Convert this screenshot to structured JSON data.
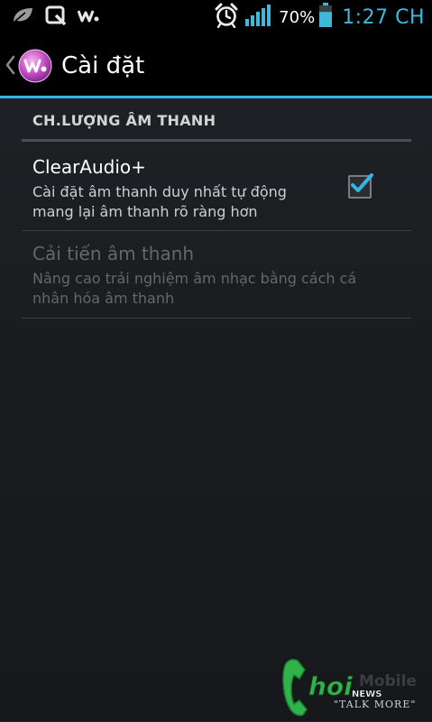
{
  "status_bar": {
    "icons_left": [
      "leaf-icon",
      "quickmemo-icon",
      "walkman-icon"
    ],
    "icons_right": [
      "alarm-icon",
      "signal-icon",
      "battery-icon"
    ],
    "battery_percent": "70%",
    "battery_level": 0.7,
    "time": "1:27 CH",
    "accent_color": "#3fb8d9"
  },
  "action_bar": {
    "title": "Cài đặt",
    "app_icon": "walkman-app-icon",
    "accent_color": "#33b5e5"
  },
  "settings": {
    "section_header": "CH.LƯỢNG ÂM THANH",
    "items": [
      {
        "title": "ClearAudio+",
        "summary": "Cài đặt âm thanh duy nhất tự động mang lại âm thanh rõ ràng hơn",
        "checked": true,
        "enabled": true
      },
      {
        "title": "Cải tiến âm thanh",
        "summary": "Nâng cao trải nghiệm âm nhạc bằng cách cá nhân hóa âm thanh",
        "enabled": false
      }
    ]
  },
  "watermark": {
    "brand": "ChoiMobile",
    "slogan": "\"TALK MORE\"",
    "brand_color": "#2fb34a"
  }
}
